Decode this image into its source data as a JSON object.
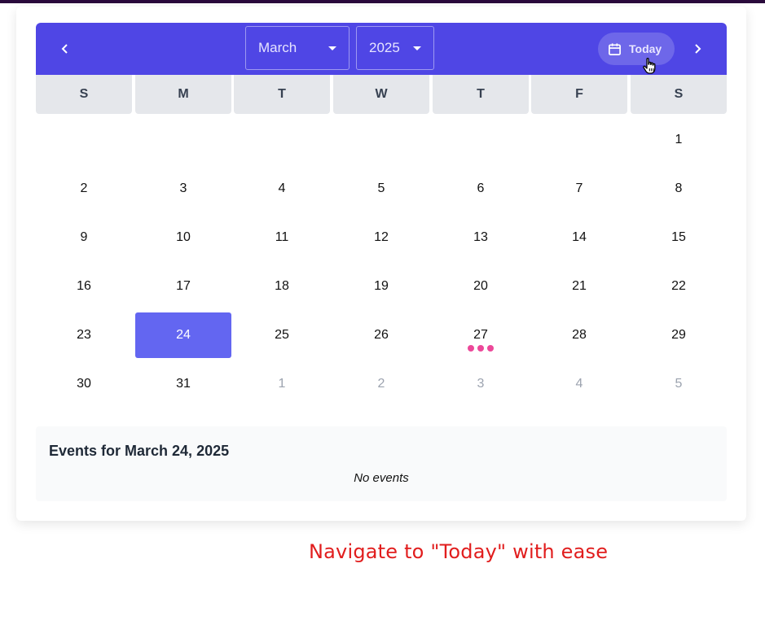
{
  "header": {
    "month": "March",
    "year": "2025",
    "today_label": "Today"
  },
  "weekdays": [
    "S",
    "M",
    "T",
    "W",
    "T",
    "F",
    "S"
  ],
  "days": [
    {
      "label": "1",
      "outside": false
    },
    {
      "label": "2",
      "outside": false
    },
    {
      "label": "3",
      "outside": false
    },
    {
      "label": "4",
      "outside": false
    },
    {
      "label": "5",
      "outside": false
    },
    {
      "label": "6",
      "outside": false
    },
    {
      "label": "7",
      "outside": false
    },
    {
      "label": "8",
      "outside": false
    },
    {
      "label": "9",
      "outside": false
    },
    {
      "label": "10",
      "outside": false
    },
    {
      "label": "11",
      "outside": false
    },
    {
      "label": "12",
      "outside": false
    },
    {
      "label": "13",
      "outside": false
    },
    {
      "label": "14",
      "outside": false
    },
    {
      "label": "15",
      "outside": false
    },
    {
      "label": "16",
      "outside": false
    },
    {
      "label": "17",
      "outside": false
    },
    {
      "label": "18",
      "outside": false
    },
    {
      "label": "19",
      "outside": false
    },
    {
      "label": "20",
      "outside": false
    },
    {
      "label": "21",
      "outside": false
    },
    {
      "label": "22",
      "outside": false
    },
    {
      "label": "23",
      "outside": false
    },
    {
      "label": "24",
      "outside": false,
      "selected": true
    },
    {
      "label": "25",
      "outside": false
    },
    {
      "label": "26",
      "outside": false
    },
    {
      "label": "27",
      "outside": false,
      "has_events": true
    },
    {
      "label": "28",
      "outside": false
    },
    {
      "label": "29",
      "outside": false
    },
    {
      "label": "30",
      "outside": false
    },
    {
      "label": "31",
      "outside": false
    },
    {
      "label": "1",
      "outside": true
    },
    {
      "label": "2",
      "outside": true
    },
    {
      "label": "3",
      "outside": true
    },
    {
      "label": "4",
      "outside": true
    },
    {
      "label": "5",
      "outside": true
    }
  ],
  "events": {
    "title": "Events for March 24, 2025",
    "empty_text": "No events"
  },
  "caption": "Navigate to \"Today\" with ease",
  "colors": {
    "header": "#4f46e5",
    "selected_day": "#6366f1",
    "event_dot": "#ec4899",
    "caption": "#e11d1d"
  },
  "icons": [
    "chevron-left-icon",
    "chevron-right-icon",
    "calendar-icon",
    "dropdown-caret-icon",
    "hand-pointer-icon"
  ]
}
